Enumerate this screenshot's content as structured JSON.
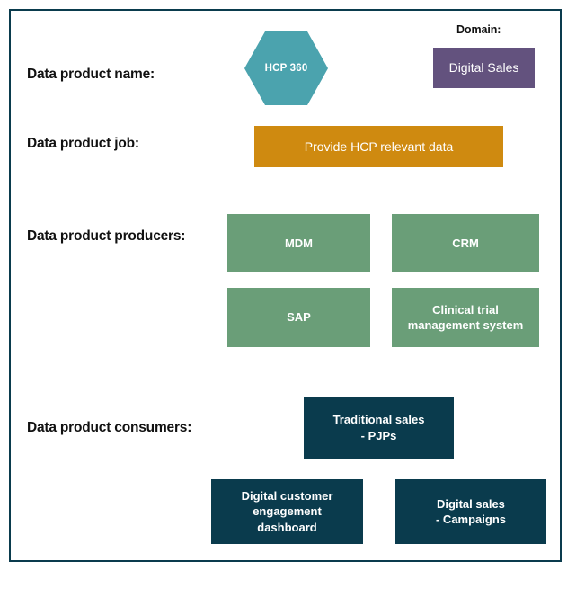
{
  "diagram": {
    "border_color": "#0a3b4d",
    "background": "#ffffff",
    "rows": [
      {
        "label": "Data product name:"
      },
      {
        "label": "Data product job:"
      },
      {
        "label": "Data product producers:"
      },
      {
        "label": "Data product consumers:"
      }
    ]
  },
  "domain": {
    "caption": "Domain:",
    "value": "Digital Sales",
    "color": "#63527e"
  },
  "product_name": {
    "value": "HCP 360",
    "shape": "hexagon",
    "color": "#4ba3ae"
  },
  "product_job": {
    "value": "Provide HCP relevant data",
    "color": "#cf8a10"
  },
  "producers": {
    "color": "#6a9e78",
    "items": [
      {
        "label": "MDM"
      },
      {
        "label": "CRM"
      },
      {
        "label": "SAP"
      },
      {
        "label": "Clinical trial\nmanagement system"
      }
    ]
  },
  "consumers": {
    "color": "#0a3b4d",
    "items": [
      {
        "label": "Traditional sales\n- PJPs"
      },
      {
        "label": "Digital customer\nengagement\ndashboard"
      },
      {
        "label": "Digital sales\n- Campaigns"
      }
    ]
  }
}
